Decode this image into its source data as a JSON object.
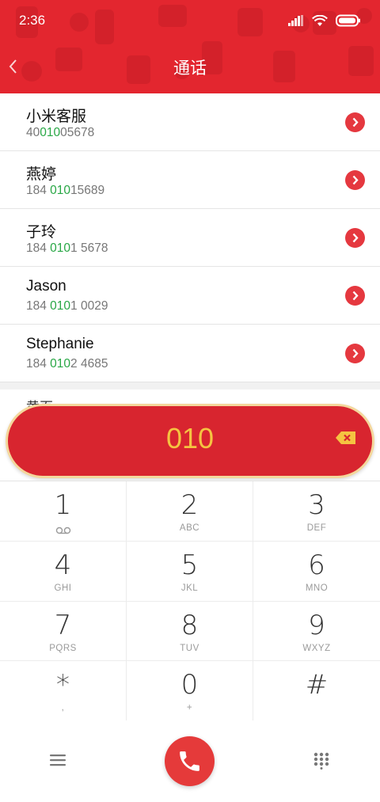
{
  "status_bar": {
    "time": "2:36",
    "icons": [
      "signal-icon",
      "wifi-icon",
      "battery-icon"
    ]
  },
  "header": {
    "title": "通话",
    "back_icon": "chevron-left-icon",
    "background_color": "#e3262f"
  },
  "results": [
    {
      "name": "小米客服",
      "number_pre": "40",
      "number_match": "010",
      "number_post": "05678"
    },
    {
      "name": "燕婷",
      "number_pre": "184 ",
      "number_match": "010",
      "number_post": "15689"
    },
    {
      "name": "子玲",
      "number_pre": "184 ",
      "number_match": "010",
      "number_post": "1 5678"
    },
    {
      "name": "Jason",
      "number_pre": "184 ",
      "number_match": "010",
      "number_post": "1 0029"
    },
    {
      "name": "Stephanie",
      "number_pre": "184 ",
      "number_match": "010",
      "number_post": "2 4685"
    }
  ],
  "peek_contact": {
    "name": "黄页"
  },
  "dial_display": {
    "digits": "010",
    "backspace_icon": "backspace-icon",
    "digit_color": "#f5c341",
    "pill_color": "#d8252f"
  },
  "keypad": [
    {
      "digit": "1",
      "sub": ""
    },
    {
      "digit": "2",
      "sub": "ABC"
    },
    {
      "digit": "3",
      "sub": "DEF"
    },
    {
      "digit": "4",
      "sub": "GHI"
    },
    {
      "digit": "5",
      "sub": "JKL"
    },
    {
      "digit": "6",
      "sub": "MNO"
    },
    {
      "digit": "7",
      "sub": "PQRS"
    },
    {
      "digit": "8",
      "sub": "TUV"
    },
    {
      "digit": "9",
      "sub": "WXYZ"
    },
    {
      "digit": "*",
      "sub": ","
    },
    {
      "digit": "0",
      "sub": "+"
    },
    {
      "digit": "#",
      "sub": ""
    }
  ],
  "bottom_bar": {
    "menu_icon": "menu-icon",
    "call_icon": "phone-icon",
    "dialpad_icon": "dialpad-icon",
    "call_color": "#e53a3a"
  },
  "colors": {
    "match_highlight": "#28a745",
    "arrow_button": "#e5383f"
  }
}
